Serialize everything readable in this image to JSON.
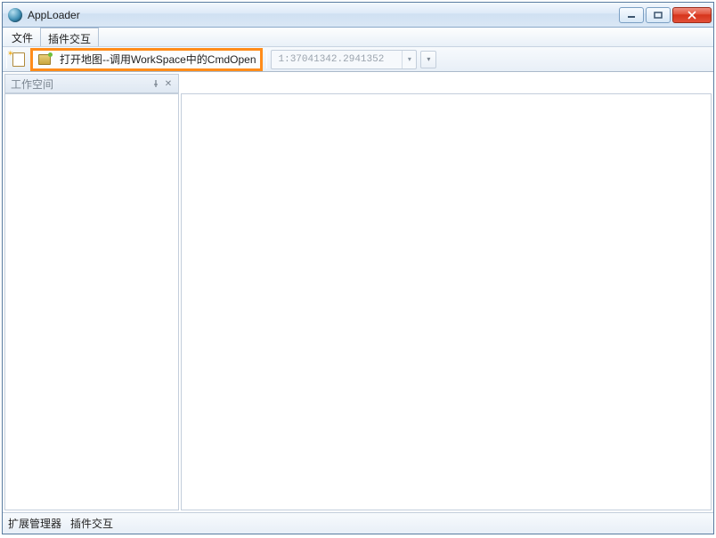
{
  "titlebar": {
    "title": "AppLoader"
  },
  "menubar": {
    "items": [
      "文件",
      "插件交互"
    ]
  },
  "toolbar": {
    "open_map_label": "打开地图--调用WorkSpace中的CmdOpen",
    "scale_value": "1:37041342.2941352"
  },
  "side_panel": {
    "title": "工作空间"
  },
  "statusbar": {
    "items": [
      "扩展管理器",
      "插件交互"
    ]
  }
}
